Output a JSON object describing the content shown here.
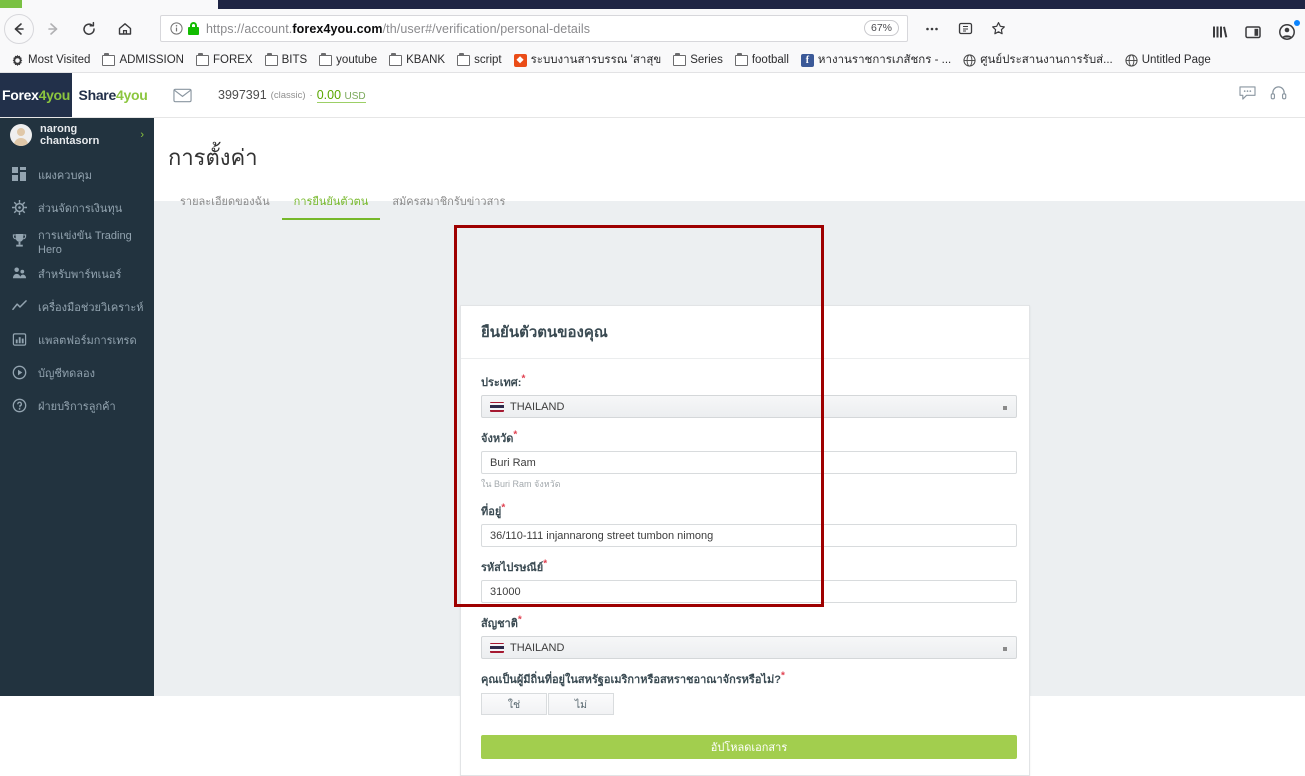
{
  "browser": {
    "url_prefix": "https://account.",
    "url_domain": "forex4you.com",
    "url_path": "/th/user#/verification/personal-details",
    "zoom_level": "67%",
    "nav": {
      "back": "back-arrow",
      "forward": "forward-arrow",
      "reload": "reload",
      "home": "home"
    },
    "icons": {
      "info": "info-icon",
      "lock": "lock-icon",
      "menu": "more-menu-icon",
      "reader": "reader-icon",
      "star": "bookmark-star-icon",
      "library": "library-icon",
      "sidebar": "sidebar-icon",
      "account": "account-icon"
    },
    "bookmarks": [
      {
        "label": "Most Visited",
        "icon": "gear-icon"
      },
      {
        "label": "ADMISSION",
        "icon": "folder-icon"
      },
      {
        "label": "FOREX",
        "icon": "folder-icon"
      },
      {
        "label": "BITS",
        "icon": "folder-icon"
      },
      {
        "label": "youtube",
        "icon": "folder-icon"
      },
      {
        "label": "KBANK",
        "icon": "folder-icon"
      },
      {
        "label": "script",
        "icon": "folder-icon"
      },
      {
        "label": "ระบบงานสารบรรณ 'สาสุข",
        "icon": "orange-favicon"
      },
      {
        "label": "Series",
        "icon": "folder-icon"
      },
      {
        "label": "football",
        "icon": "folder-icon"
      },
      {
        "label": "หางานราชการเภสัชกร - ...",
        "icon": "facebook-icon"
      },
      {
        "label": "ศูนย์ประสานงานการรับส่...",
        "icon": "globe-icon"
      },
      {
        "label": "Untitled Page",
        "icon": "globe-icon"
      }
    ]
  },
  "app_header": {
    "logo_primary_a": "Forex",
    "logo_primary_b": "4",
    "logo_primary_c": "you",
    "logo_secondary_a": "Share",
    "logo_secondary_b": "4",
    "logo_secondary_c": "you",
    "mail_icon": "envelope-icon",
    "account_number": "3997391",
    "account_type": "(classic)",
    "separator": "·",
    "balance": "0.00",
    "balance_currency": "USD",
    "chat_icon": "chat-icon",
    "support_icon": "headset-icon"
  },
  "sidebar": {
    "user_name": "narong chantasorn",
    "chevron": "›",
    "items": [
      {
        "label": "แผงควบคุม",
        "icon": "dashboard-icon"
      },
      {
        "label": "ส่วนจัดการเงินทุน",
        "icon": "funds-icon"
      },
      {
        "label": "การแข่งขัน Trading Hero",
        "icon": "trophy-icon"
      },
      {
        "label": "สำหรับพาร์ทเนอร์",
        "icon": "partners-icon"
      },
      {
        "label": "เครื่องมือช่วยวิเคราะห์",
        "icon": "analytics-icon"
      },
      {
        "label": "แพลตฟอร์มการเทรด",
        "icon": "platform-icon"
      },
      {
        "label": "บัญชีทดลอง",
        "icon": "demo-account-icon"
      },
      {
        "label": "ฝ่ายบริการลูกค้า",
        "icon": "support-question-icon"
      }
    ]
  },
  "page": {
    "title": "การตั้งค่า",
    "tabs": [
      {
        "label": "รายละเอียดของฉัน",
        "active": false
      },
      {
        "label": "การยืนยันตัวตน",
        "active": true
      },
      {
        "label": "สมัครสมาชิกรับข่าวสาร",
        "active": false
      }
    ]
  },
  "form": {
    "card_title": "ยืนยันตัวตนของคุณ",
    "required_mark": "*",
    "fields": {
      "country": {
        "label": "ประเทศ:",
        "value": "THAILAND",
        "flag": "thailand-flag-icon",
        "type": "select"
      },
      "province": {
        "label": "จังหวัด",
        "value": "Buri Ram",
        "hint": "ใน Buri Ram จังหวัด",
        "type": "text"
      },
      "address": {
        "label": "ที่อยู่",
        "value": "36/110-111 injannarong street tumbon nimong",
        "type": "text"
      },
      "postcode": {
        "label": "รหัสไปรษณีย์",
        "value": "31000",
        "type": "text"
      },
      "nationality": {
        "label": "สัญชาติ",
        "value": "THAILAND",
        "flag": "thailand-flag-icon",
        "type": "select"
      },
      "us_uk_resident": {
        "label": "คุณเป็นผู้มีถิ่นที่อยู่ในสหรัฐอเมริกาหรือสหราชอาณาจักรหรือไม่?",
        "yes_label": "ใช่",
        "no_label": "ไม่"
      }
    },
    "upload_button": "อัปโหลดเอกสาร"
  },
  "colors": {
    "accent_green": "#76b82a",
    "button_green": "#a2ce4e",
    "sidebar_bg": "#22333f",
    "logo_navy": "#22304a",
    "annotation_red": "#9e0000",
    "required_red": "#e04050"
  }
}
